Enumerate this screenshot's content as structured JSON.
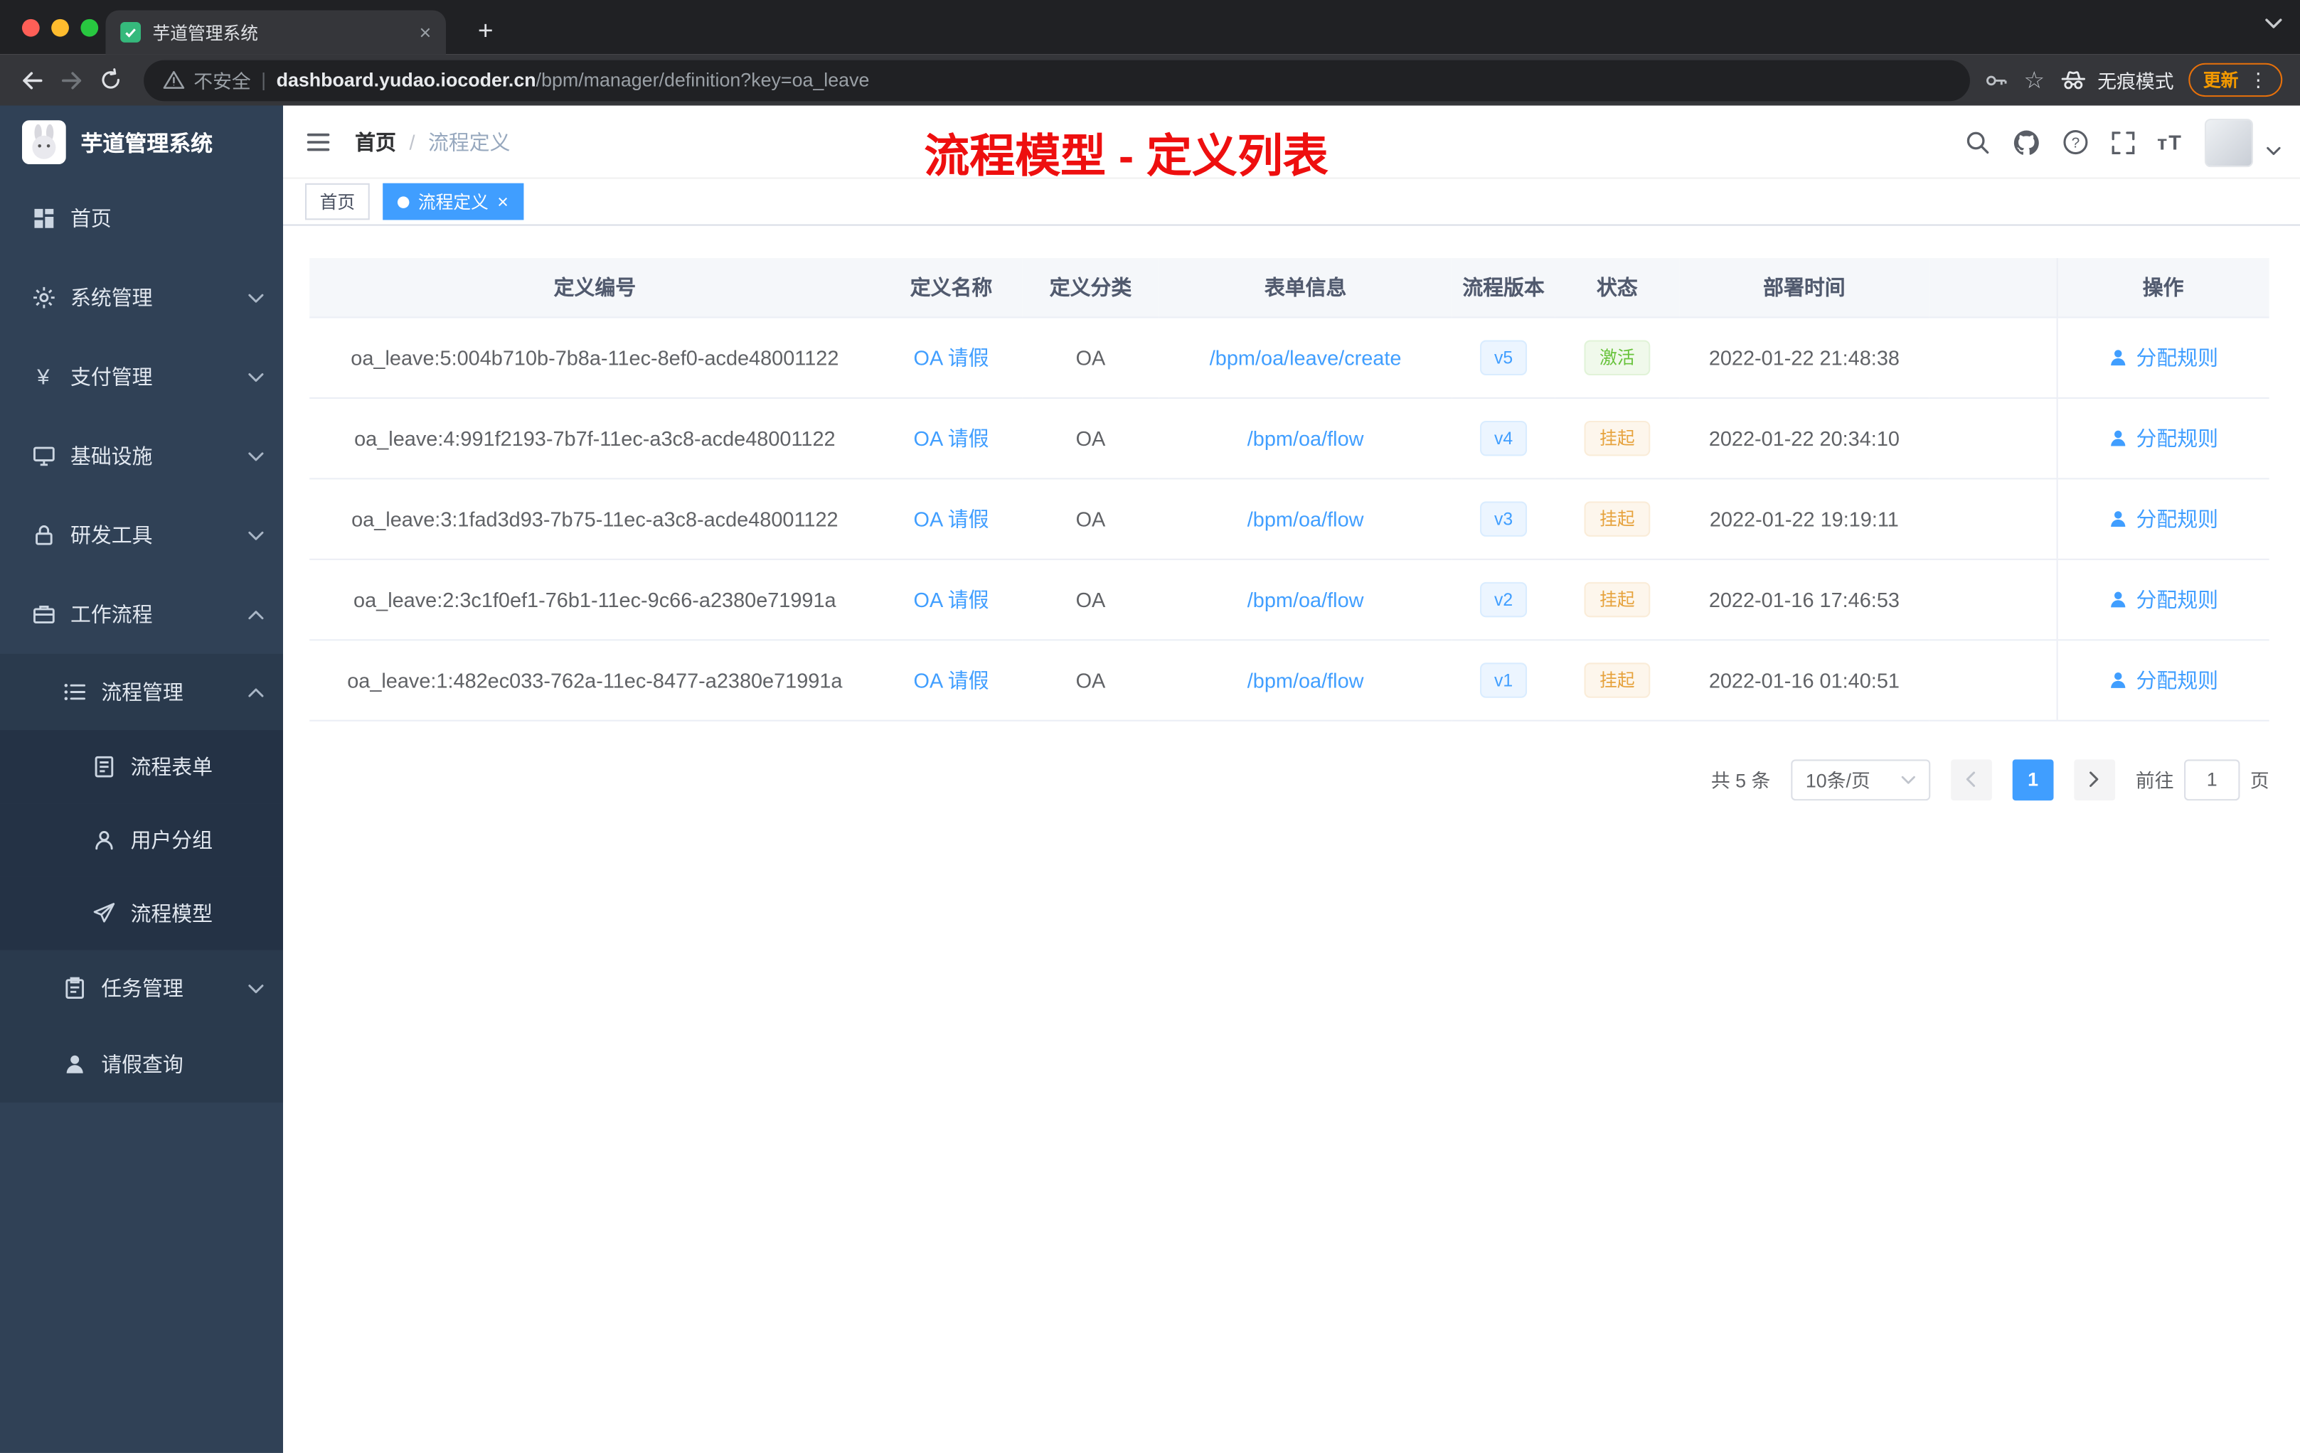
{
  "browser": {
    "tab_title": "芋道管理系统",
    "security_label": "不安全",
    "url_domain": "dashboard.yudao.iocoder.cn",
    "url_path": "/bpm/manager/definition?key=oa_leave",
    "incognito_label": "无痕模式",
    "update_label": "更新"
  },
  "icons": {
    "tab_close": "×",
    "new_tab": "+",
    "star": "☆",
    "menu_dots": "⋮",
    "yen": "¥",
    "font_size": "тT",
    "url_divider": "|"
  },
  "sidebar": {
    "logo_title": "芋道管理系统",
    "items": [
      {
        "label": "首页"
      },
      {
        "label": "系统管理"
      },
      {
        "label": "支付管理"
      },
      {
        "label": "基础设施"
      },
      {
        "label": "研发工具"
      },
      {
        "label": "工作流程"
      },
      {
        "label": "流程管理"
      },
      {
        "label": "流程表单"
      },
      {
        "label": "用户分组"
      },
      {
        "label": "流程模型"
      },
      {
        "label": "任务管理"
      },
      {
        "label": "请假查询"
      }
    ]
  },
  "header": {
    "breadcrumb_home": "首页",
    "breadcrumb_sep": "/",
    "breadcrumb_current": "流程定义",
    "annotation": "流程模型 - 定义列表"
  },
  "tags": [
    {
      "label": "首页"
    },
    {
      "label": "流程定义"
    }
  ],
  "table": {
    "columns": [
      "定义编号",
      "定义名称",
      "定义分类",
      "表单信息",
      "流程版本",
      "状态",
      "部署时间",
      "操作"
    ],
    "rows": [
      {
        "id": "oa_leave:5:004b710b-7b8a-11ec-8ef0-acde48001122",
        "name": "OA 请假",
        "category": "OA",
        "form": "/bpm/oa/leave/create",
        "version": "v5",
        "status": "激活",
        "time": "2022-01-22 21:48:38",
        "action": "分配规则"
      },
      {
        "id": "oa_leave:4:991f2193-7b7f-11ec-a3c8-acde48001122",
        "name": "OA 请假",
        "category": "OA",
        "form": "/bpm/oa/flow",
        "version": "v4",
        "status": "挂起",
        "time": "2022-01-22 20:34:10",
        "action": "分配规则"
      },
      {
        "id": "oa_leave:3:1fad3d93-7b75-11ec-a3c8-acde48001122",
        "name": "OA 请假",
        "category": "OA",
        "form": "/bpm/oa/flow",
        "version": "v3",
        "status": "挂起",
        "time": "2022-01-22 19:19:11",
        "action": "分配规则"
      },
      {
        "id": "oa_leave:2:3c1f0ef1-76b1-11ec-9c66-a2380e71991a",
        "name": "OA 请假",
        "category": "OA",
        "form": "/bpm/oa/flow",
        "version": "v2",
        "status": "挂起",
        "time": "2022-01-16 17:46:53",
        "action": "分配规则"
      },
      {
        "id": "oa_leave:1:482ec033-762a-11ec-8477-a2380e71991a",
        "name": "OA 请假",
        "category": "OA",
        "form": "/bpm/oa/flow",
        "version": "v1",
        "status": "挂起",
        "time": "2022-01-16 01:40:51",
        "action": "分配规则"
      }
    ]
  },
  "pagination": {
    "total": "共 5 条",
    "page_size": "10条/页",
    "current_page": "1",
    "goto_label": "前往",
    "goto_value": "1",
    "goto_unit": "页"
  },
  "colors": {
    "accent": "#409eff",
    "success": "#67c23a",
    "warning": "#e6a23c",
    "annotation": "#ee0f0f",
    "sidebar_bg": "#304156"
  }
}
